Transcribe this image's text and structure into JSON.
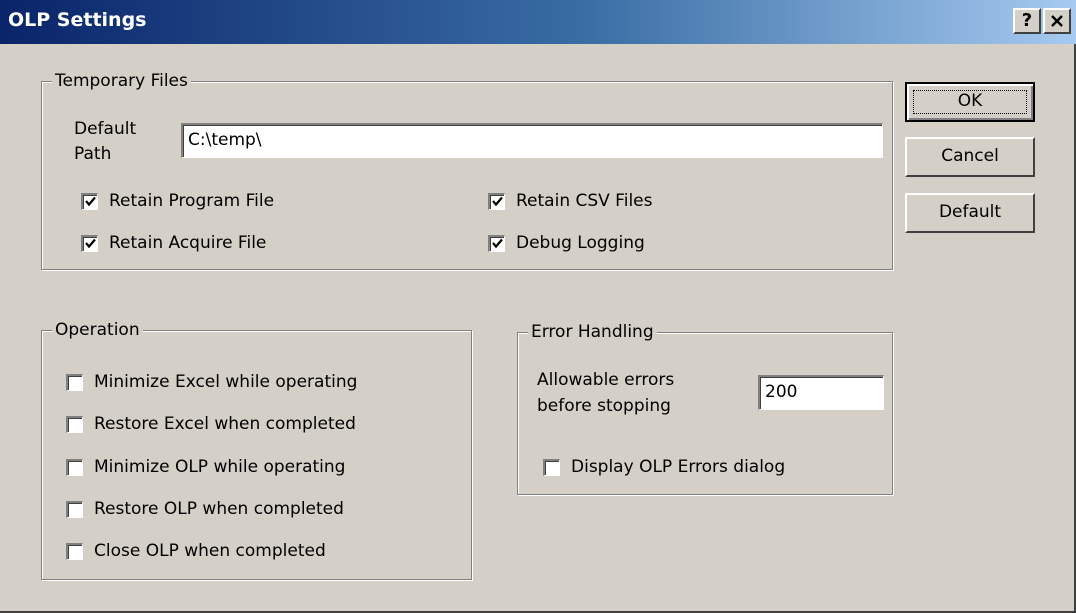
{
  "window": {
    "title": "OLP Settings",
    "help_button": "?",
    "close_button": "✕"
  },
  "temporary_files": {
    "legend": "Temporary Files",
    "default_path_label_line1": "Default",
    "default_path_label_line2": "Path",
    "default_path_value": "C:\\temp\\",
    "checkboxes": [
      {
        "label": "Retain Program File",
        "checked": true
      },
      {
        "label": "Retain Acquire File",
        "checked": true
      },
      {
        "label": "Retain CSV Files",
        "checked": true
      },
      {
        "label": "Debug Logging",
        "checked": true
      }
    ]
  },
  "operation": {
    "legend": "Operation",
    "checkboxes": [
      {
        "label": "Minimize Excel while operating",
        "checked": false
      },
      {
        "label": "Restore Excel when completed",
        "checked": false
      },
      {
        "label": "Minimize OLP while operating",
        "checked": false
      },
      {
        "label": "Restore OLP when completed",
        "checked": false
      },
      {
        "label": "Close OLP when completed",
        "checked": false
      }
    ]
  },
  "error_handling": {
    "legend": "Error Handling",
    "allowable_label_line1": "Allowable errors",
    "allowable_label_line2": "before stopping",
    "allowable_value": "200",
    "display_errors": {
      "label": "Display OLP Errors dialog",
      "checked": false
    }
  },
  "buttons": {
    "ok": "OK",
    "cancel": "Cancel",
    "default": "Default"
  }
}
